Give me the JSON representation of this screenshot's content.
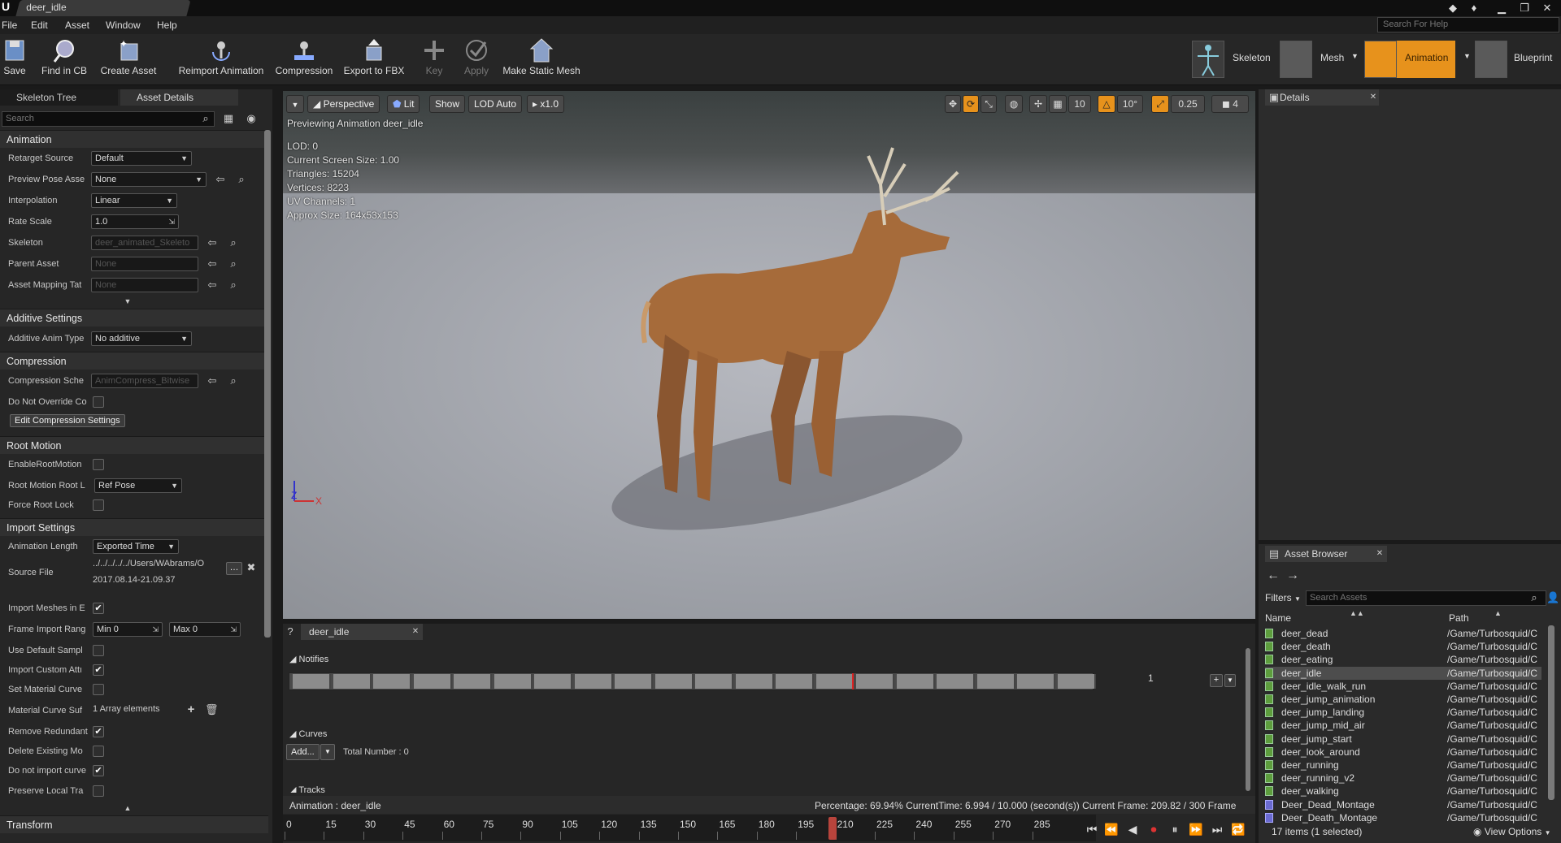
{
  "window": {
    "tab": "deer_idle"
  },
  "menu": [
    "File",
    "Edit",
    "Asset",
    "Window",
    "Help"
  ],
  "help_search_placeholder": "Search For Help",
  "toolbar": {
    "save": "Save",
    "find_in_cb": "Find in CB",
    "create_asset": "Create Asset",
    "reimport": "Reimport Animation",
    "compression": "Compression",
    "export_fbx": "Export to FBX",
    "key": "Key",
    "apply": "Apply",
    "make_static_mesh": "Make Static Mesh"
  },
  "modes": {
    "skeleton": "Skeleton",
    "mesh": "Mesh",
    "animation": "Animation",
    "blueprint": "Blueprint"
  },
  "left_tabs": {
    "skeleton_tree": "Skeleton Tree",
    "asset_details": "Asset Details"
  },
  "left_search_placeholder": "Search",
  "sections": {
    "animation": "Animation",
    "additive": "Additive Settings",
    "compression": "Compression",
    "root_motion": "Root Motion",
    "import": "Import Settings",
    "transform": "Transform"
  },
  "props": {
    "retarget_source": {
      "label": "Retarget Source",
      "value": "Default"
    },
    "preview_pose": {
      "label": "Preview Pose Asse",
      "value": "None"
    },
    "interpolation": {
      "label": "Interpolation",
      "value": "Linear"
    },
    "rate_scale": {
      "label": "Rate Scale",
      "value": "1.0"
    },
    "skeleton": {
      "label": "Skeleton",
      "value": "deer_animated_Skeleto"
    },
    "parent_asset": {
      "label": "Parent Asset",
      "value": "None"
    },
    "asset_mapping": {
      "label": "Asset Mapping Tat",
      "value": "None"
    },
    "additive_anim": {
      "label": "Additive Anim Type",
      "value": "No additive"
    },
    "compression_scheme": {
      "label": "Compression Sche",
      "value": "AnimCompress_Bitwise"
    },
    "do_not_override": {
      "label": "Do Not Override Co"
    },
    "edit_compression": "Edit Compression Settings",
    "enable_root_motion": {
      "label": "EnableRootMotion"
    },
    "root_motion_lock": {
      "label": "Root Motion Root L",
      "value": "Ref Pose"
    },
    "force_root_lock": {
      "label": "Force Root Lock"
    },
    "animation_length": {
      "label": "Animation Length",
      "value": "Exported Time"
    },
    "source_file": {
      "label": "Source File",
      "value": "../../../../../Users/WAbrams/O",
      "date": "2017.08.14-21.09.37"
    },
    "import_meshes": {
      "label": "Import Meshes in E",
      "checked": true
    },
    "frame_import_range": {
      "label": "Frame Import Rang",
      "min": "Min 0",
      "max": "Max 0"
    },
    "use_default_sample": {
      "label": "Use Default Sampl",
      "checked": false
    },
    "import_custom_attr": {
      "label": "Import Custom Attı",
      "checked": true
    },
    "set_material_curve": {
      "label": "Set Material Curve",
      "checked": false
    },
    "material_curve_suffix": {
      "label": "Material Curve Suf",
      "value": "1 Array elements"
    },
    "remove_redundant": {
      "label": "Remove Redundant",
      "checked": true
    },
    "delete_existing": {
      "label": "Delete Existing Mo",
      "checked": false
    },
    "do_not_import_curve": {
      "label": "Do not import curve",
      "checked": true
    },
    "preserve_local": {
      "label": "Preserve Local Tra",
      "checked": false
    }
  },
  "viewport": {
    "perspective": "Perspective",
    "lit": "Lit",
    "show": "Show",
    "lod_auto": "LOD Auto",
    "speed": "x1.0",
    "preview_text": "Previewing Animation deer_idle",
    "info": [
      "LOD: 0",
      "Current Screen Size: 1.00",
      "Triangles: 15204",
      "Vertices: 8223",
      "UV Channels: 1",
      "Approx Size: 164x53x153"
    ],
    "grid_snap": "10",
    "rot_snap": "10°",
    "scale_snap": "0.25",
    "cam_speed": "4",
    "axis_z": "Z",
    "axis_x": "X"
  },
  "details_tab": "Details",
  "asset_browser": {
    "tab": "Asset Browser",
    "filters": "Filters",
    "search_placeholder": "Search Assets",
    "col_name": "Name",
    "col_path": "Path",
    "items": [
      {
        "name": "deer_dead",
        "path": "/Game/Turbosquid/C",
        "type": "anim"
      },
      {
        "name": "deer_death",
        "path": "/Game/Turbosquid/C",
        "type": "anim"
      },
      {
        "name": "deer_eating",
        "path": "/Game/Turbosquid/C",
        "type": "anim"
      },
      {
        "name": "deer_idle",
        "path": "/Game/Turbosquid/C",
        "type": "anim"
      },
      {
        "name": "deer_idle_walk_run",
        "path": "/Game/Turbosquid/C",
        "type": "anim"
      },
      {
        "name": "deer_jump_animation",
        "path": "/Game/Turbosquid/C",
        "type": "anim"
      },
      {
        "name": "deer_jump_landing",
        "path": "/Game/Turbosquid/C",
        "type": "anim"
      },
      {
        "name": "deer_jump_mid_air",
        "path": "/Game/Turbosquid/C",
        "type": "anim"
      },
      {
        "name": "deer_jump_start",
        "path": "/Game/Turbosquid/C",
        "type": "anim"
      },
      {
        "name": "deer_look_around",
        "path": "/Game/Turbosquid/C",
        "type": "anim"
      },
      {
        "name": "deer_running",
        "path": "/Game/Turbosquid/C",
        "type": "anim"
      },
      {
        "name": "deer_running_v2",
        "path": "/Game/Turbosquid/C",
        "type": "anim"
      },
      {
        "name": "deer_walking",
        "path": "/Game/Turbosquid/C",
        "type": "anim"
      },
      {
        "name": "Deer_Dead_Montage",
        "path": "/Game/Turbosquid/C",
        "type": "montage"
      },
      {
        "name": "Deer_Death_Montage",
        "path": "/Game/Turbosquid/C",
        "type": "montage"
      }
    ],
    "selected": "deer_idle",
    "count": "17 items (1 selected)",
    "view_options": "View Options"
  },
  "timeline": {
    "tab": "deer_idle",
    "notifies": "Notifies",
    "track_num": "1",
    "curves": "Curves",
    "add": "Add...",
    "total": "Total Number : 0",
    "tracks": "Tracks",
    "animation_label": "Animation : deer_idle",
    "status": "Percentage: 69.94% CurrentTime: 6.994 / 10.000 (second(s)) Current Frame: 209.82 / 300 Frame",
    "progress": 0.6994,
    "ticks": [
      "0",
      "15",
      "30",
      "45",
      "60",
      "75",
      "90",
      "105",
      "120",
      "135",
      "150",
      "165",
      "180",
      "195",
      "210",
      "225",
      "240",
      "255",
      "270",
      "285"
    ]
  }
}
